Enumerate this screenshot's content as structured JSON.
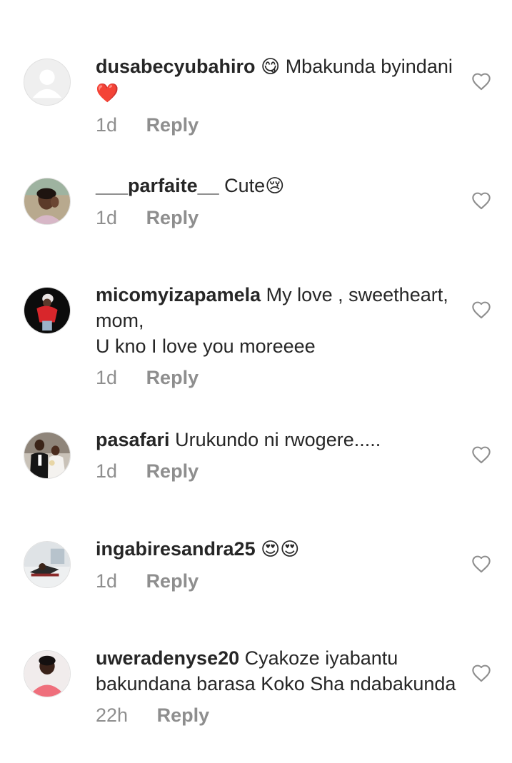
{
  "comments": [
    {
      "username": "dusabecyubahiro",
      "text_parts": [
        "😋",
        " Mbakunda byindani ",
        "❤️"
      ],
      "time": "1d",
      "reply": "Reply",
      "avatar": "default-avatar"
    },
    {
      "username": "___parfaite__",
      "text_parts": [
        "Cute",
        "😢"
      ],
      "time": "1d",
      "reply": "Reply",
      "avatar": "woman-photo"
    },
    {
      "username": "micomyizapamela",
      "text_lines": [
        "My love , sweetheart,",
        "mom,",
        "U kno I love you moreeee"
      ],
      "time": "1d",
      "reply": "Reply",
      "avatar": "red-jacket-photo"
    },
    {
      "username": "pasafari",
      "text": "Urukundo ni rwogere.....",
      "time": "1d",
      "reply": "Reply",
      "avatar": "wedding-photo"
    },
    {
      "username": "ingabiresandra25",
      "text_parts": [
        "😍😍"
      ],
      "time": "1d",
      "reply": "Reply",
      "avatar": "room-photo"
    },
    {
      "username": "uweradenyse20",
      "text": "Cyakoze iyabantu bakundana barasa Koko Sha ndabakunda",
      "time": "22h",
      "reply": "Reply",
      "avatar": "woman-pink-photo"
    }
  ],
  "colors": {
    "text": "#262626",
    "meta": "#8e8e8e",
    "heart": "#ed4956",
    "icon": "#8e8e8e"
  }
}
